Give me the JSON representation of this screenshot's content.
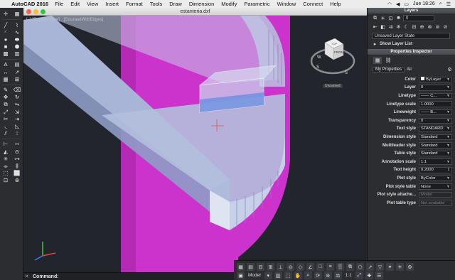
{
  "menubar": {
    "app": "AutoCAD 2016",
    "items": [
      "File",
      "Edit",
      "View",
      "Insert",
      "Format",
      "Tools",
      "Draw",
      "Dimension",
      "Modify",
      "Parametric",
      "Window",
      "Connect",
      "Help"
    ],
    "clock": "Jue 18:26"
  },
  "window": {
    "title": "estanteria.dxf"
  },
  "viewport": {
    "view_name": "[–] [Custom View]",
    "visual_style": "[GouraudWithEdges]",
    "viewcube": {
      "top": "TOP",
      "front": "FRONT",
      "compass": [
        "N",
        "E",
        "S",
        "W"
      ]
    },
    "ucs_name": "Unnamed"
  },
  "command": {
    "label": "Command:",
    "placeholder": ""
  },
  "statusbar": {
    "model_label": "Model",
    "scale": "1:1"
  },
  "layers": {
    "header": "Layers",
    "current_layer": "0",
    "layer_state": "Unsaved Layer State",
    "show_list": "Show Layer List"
  },
  "properties": {
    "header": "Properties Inspector",
    "filter_label": "My Properties",
    "filter_value": "All",
    "rows": [
      {
        "label": "Color",
        "value": "ByLayer",
        "swatch": "#ffffff",
        "dd": true
      },
      {
        "label": "Layer",
        "value": "0",
        "dd": true
      },
      {
        "label": "Linetype",
        "value": "—— C...",
        "dd": true
      },
      {
        "label": "Linetype scale",
        "value": "1.0000",
        "dd": false
      },
      {
        "label": "Lineweight",
        "value": "—— B...",
        "dd": true
      },
      {
        "label": "Transparency",
        "value": "0",
        "dd": true
      },
      {
        "label": "Text style",
        "value": "STANDARD",
        "dd": true
      },
      {
        "label": "Dimension style",
        "value": "Standard",
        "dd": true
      },
      {
        "label": "Multileader style",
        "value": "Standard",
        "dd": true
      },
      {
        "label": "Table style",
        "value": "Standard",
        "dd": true
      },
      {
        "label": "Annotation scale",
        "value": "1:1",
        "dd": true
      },
      {
        "label": "Text height",
        "value": "0.2000",
        "dd": false
      },
      {
        "label": "Plot style",
        "value": "ByColor",
        "dd": true
      },
      {
        "label": "Plot style table",
        "value": "None",
        "dd": true
      },
      {
        "label": "Plot style attache...",
        "value": "Model",
        "disabled": true
      },
      {
        "label": "Plot table type",
        "value": "Not available",
        "disabled": true
      }
    ]
  },
  "colors": {
    "magenta": "#cc33cc",
    "shelf": "#a9b6d6",
    "accent": "#4b7fd1"
  }
}
